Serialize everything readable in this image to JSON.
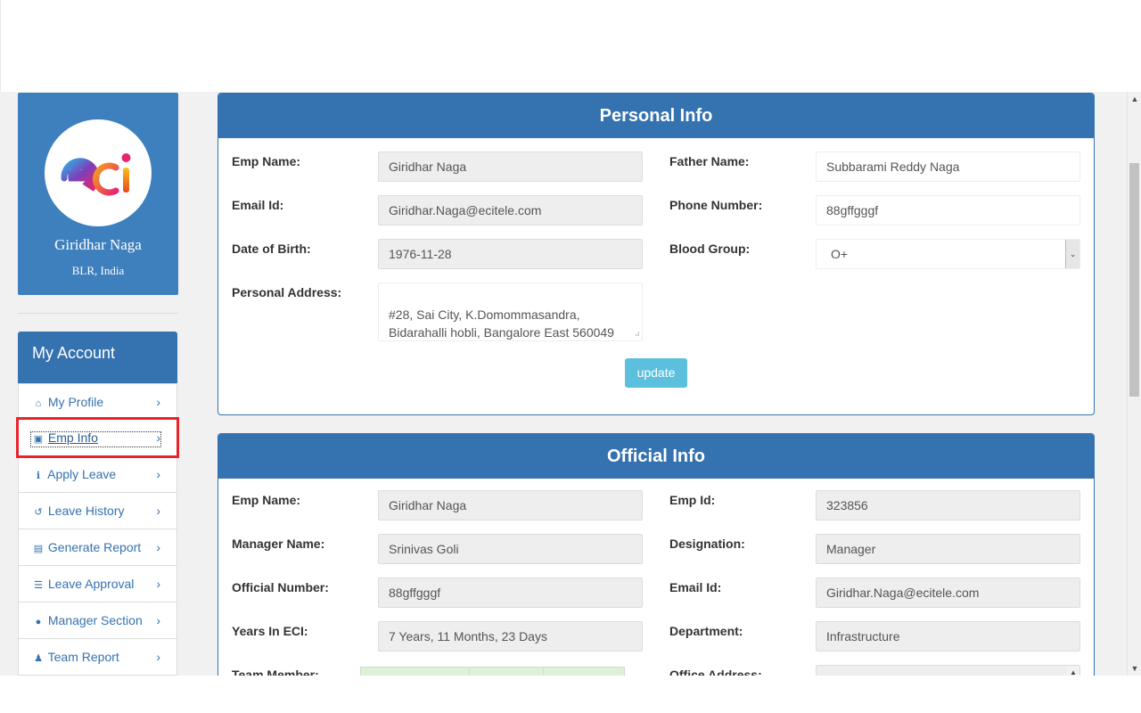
{
  "profile": {
    "name": "Giridhar Naga",
    "location": "BLR, India",
    "logo_text": "eci"
  },
  "sidebar": {
    "heading": "My Account",
    "items": [
      {
        "label": "My Profile",
        "icon": "home-icon",
        "glyph": "⌂"
      },
      {
        "label": "Emp Info",
        "icon": "lock-icon",
        "glyph": "▣"
      },
      {
        "label": "Apply Leave",
        "icon": "info-icon",
        "glyph": "ℹ"
      },
      {
        "label": "Leave History",
        "icon": "history-icon",
        "glyph": "↺"
      },
      {
        "label": "Generate Report",
        "icon": "file-excel-icon",
        "glyph": "▤"
      },
      {
        "label": "Leave Approval",
        "icon": "list-icon",
        "glyph": "☰"
      },
      {
        "label": "Manager Section",
        "icon": "user-icon",
        "glyph": "●"
      },
      {
        "label": "Team Report",
        "icon": "users-icon",
        "glyph": "♟"
      }
    ],
    "chevron": "›"
  },
  "personal_info": {
    "title": "Personal Info",
    "emp_name_label": "Emp Name:",
    "emp_name": "Giridhar Naga",
    "father_name_label": "Father Name:",
    "father_name": "Subbarami Reddy Naga",
    "email_label": "Email Id:",
    "email": "Giridhar.Naga@ecitele.com",
    "phone_label": "Phone Number:",
    "phone": "88gffgggf",
    "dob_label": "Date of Birth:",
    "dob": "1976-11-28",
    "blood_group_label": "Blood Group:",
    "blood_group": "O+",
    "address_label": "Personal Address:",
    "address": "#28, Sai City, K.Domommasandra,\nBidarahalli hobli, Bangalore East 560049",
    "update_label": "update"
  },
  "official_info": {
    "title": "Official Info",
    "emp_name_label": "Emp Name:",
    "emp_name": "Giridhar Naga",
    "emp_id_label": "Emp Id:",
    "emp_id": "323856",
    "manager_label": "Manager Name:",
    "manager": "Srinivas Goli",
    "designation_label": "Designation:",
    "designation": "Manager",
    "official_number_label": "Official Number:",
    "official_number": "88gffgggf",
    "email_label": "Email Id:",
    "email": "Giridhar.Naga@ecitele.com",
    "years_label": "Years In ECI:",
    "years": "7 Years, 11 Months, 23 Days",
    "department_label": "Department:",
    "department": "Infrastructure",
    "team_member_label": "Team Member:",
    "office_address_label": "Office Address:"
  },
  "colors": {
    "primary": "#3572b0",
    "profile_card": "#3e7fbe",
    "update_button": "#5bc0de",
    "highlight": "#e8242b"
  }
}
